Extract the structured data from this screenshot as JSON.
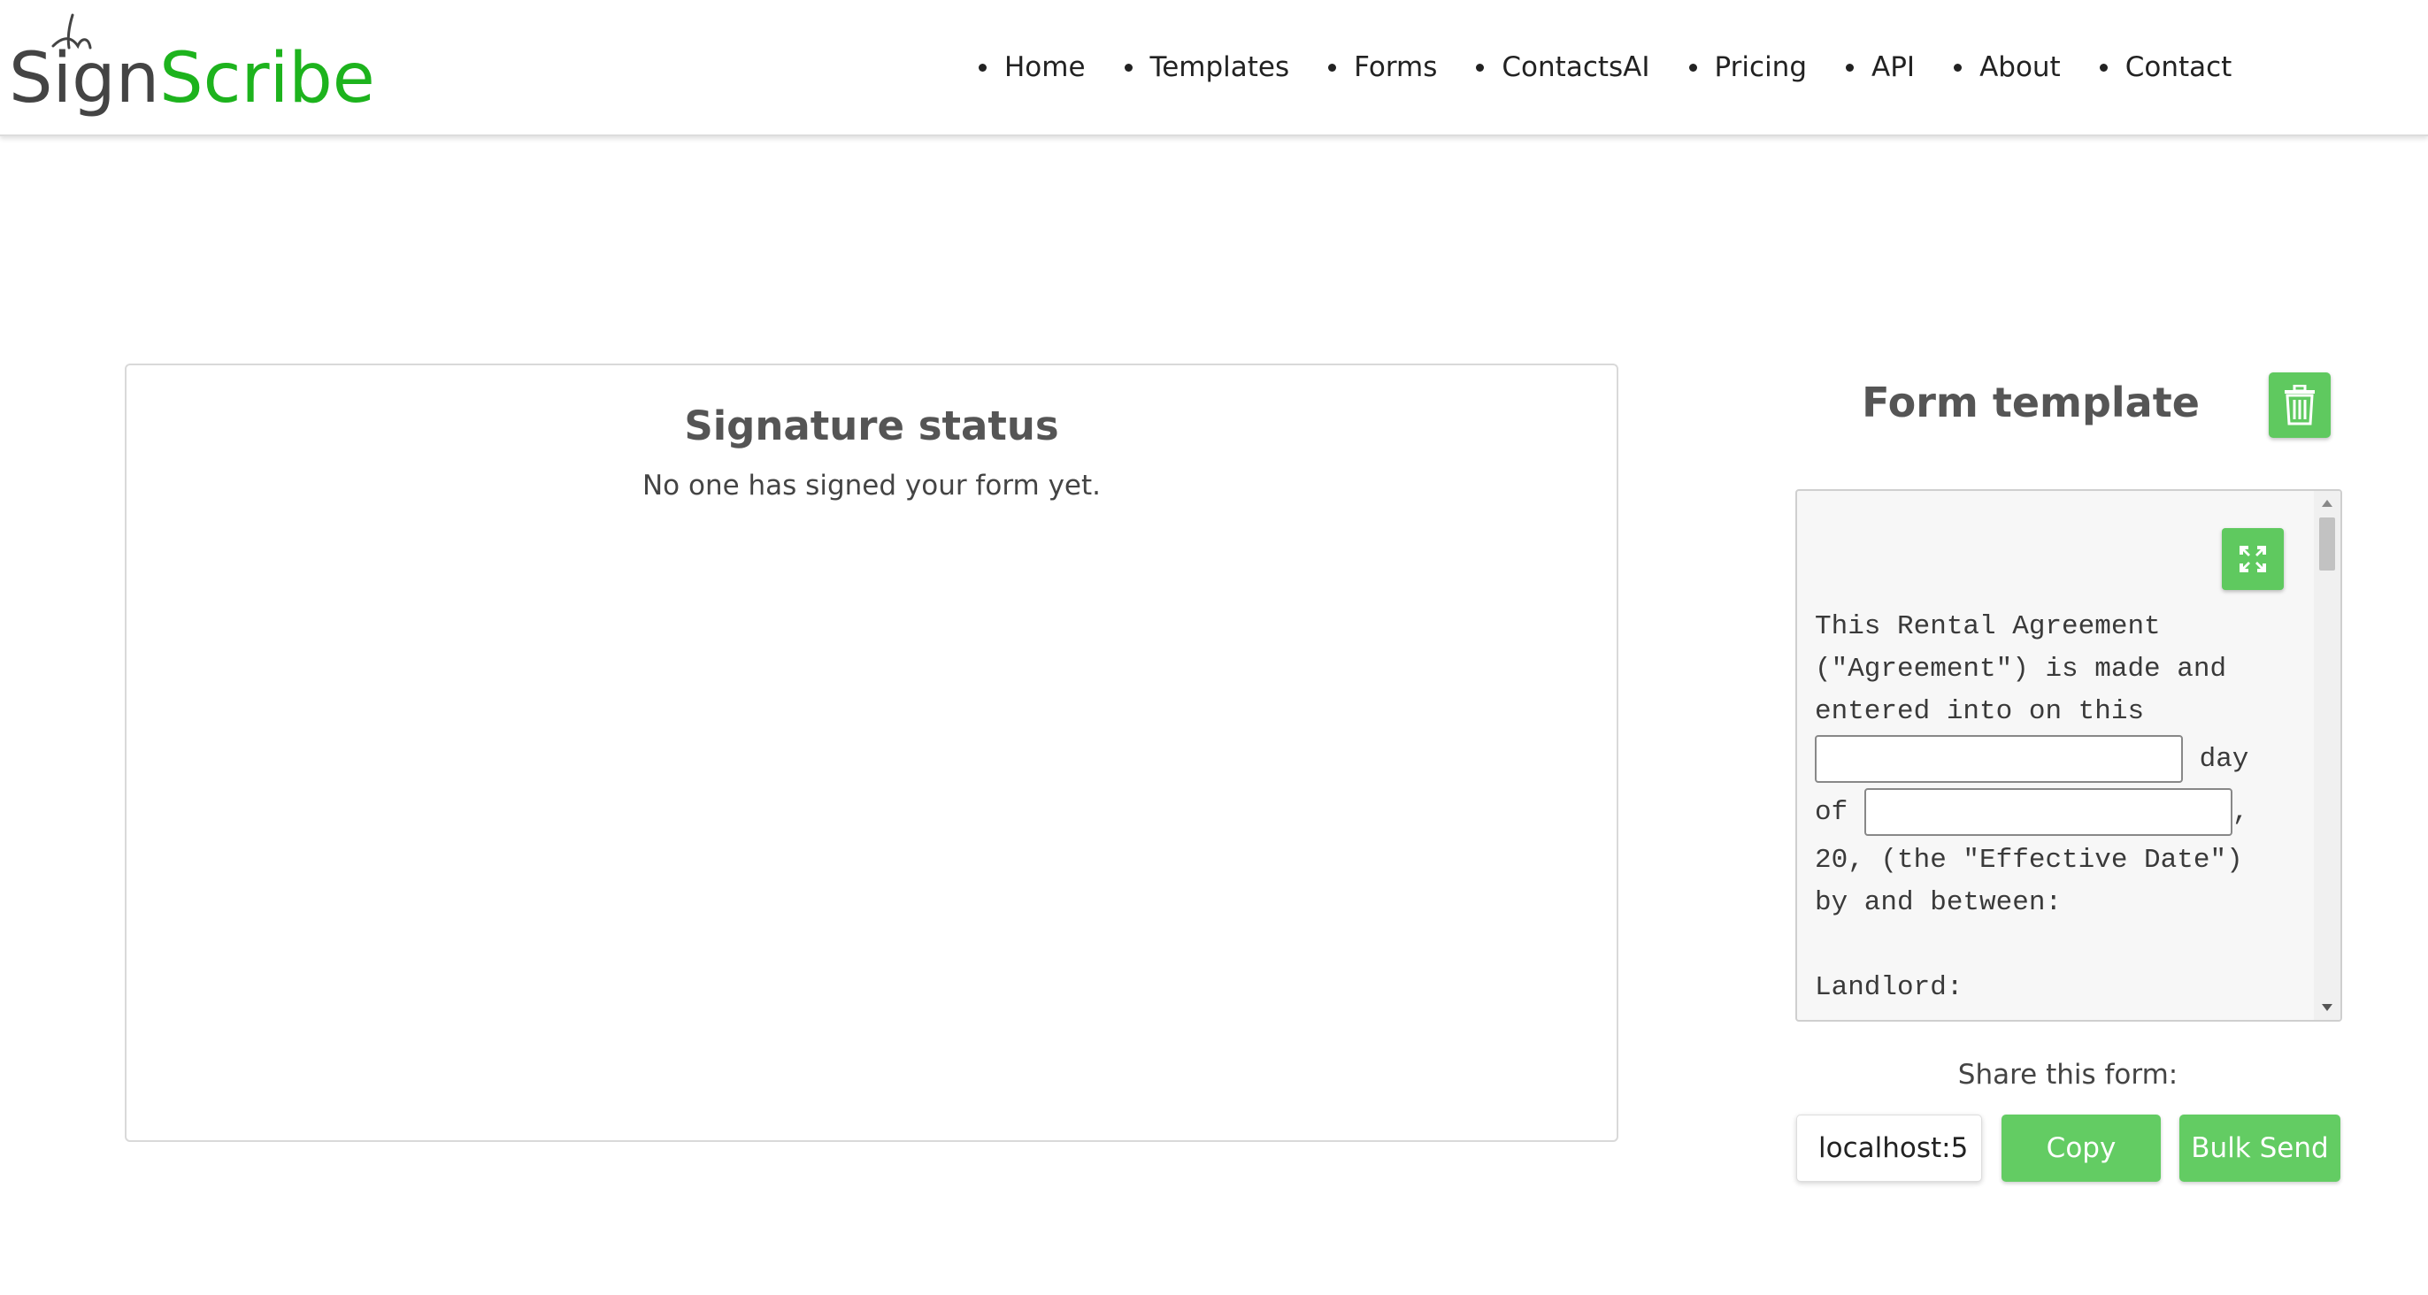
{
  "brand": {
    "name_part1": "Sign",
    "name_part2": "Scribe",
    "color_primary": "#444444",
    "color_accent": "#1db31d"
  },
  "nav": {
    "items": [
      {
        "label": "Home"
      },
      {
        "label": "Templates"
      },
      {
        "label": "Forms"
      },
      {
        "label": "ContactsAI"
      },
      {
        "label": "Pricing"
      },
      {
        "label": "API"
      },
      {
        "label": "About"
      },
      {
        "label": "Contact"
      }
    ]
  },
  "status": {
    "title": "Signature status",
    "message": "No one has signed your form yet."
  },
  "template": {
    "title": "Form template",
    "delete_icon": "trash-icon",
    "expand_icon": "expand-icon",
    "text": {
      "line1": "This Rental Agreement",
      "line2": "(\"Agreement\") is made and",
      "line3": "entered into on this",
      "after_input1": " day",
      "before_input2": "of ",
      "after_input2": ",",
      "line6": "20, (the \"Effective Date\")",
      "line7": "by and between:",
      "line9": "Landlord:"
    }
  },
  "share": {
    "label": "Share this form:",
    "url_value": "localhost:5",
    "copy_label": "Copy",
    "bulk_label": "Bulk Send",
    "button_color": "#63cc63"
  }
}
